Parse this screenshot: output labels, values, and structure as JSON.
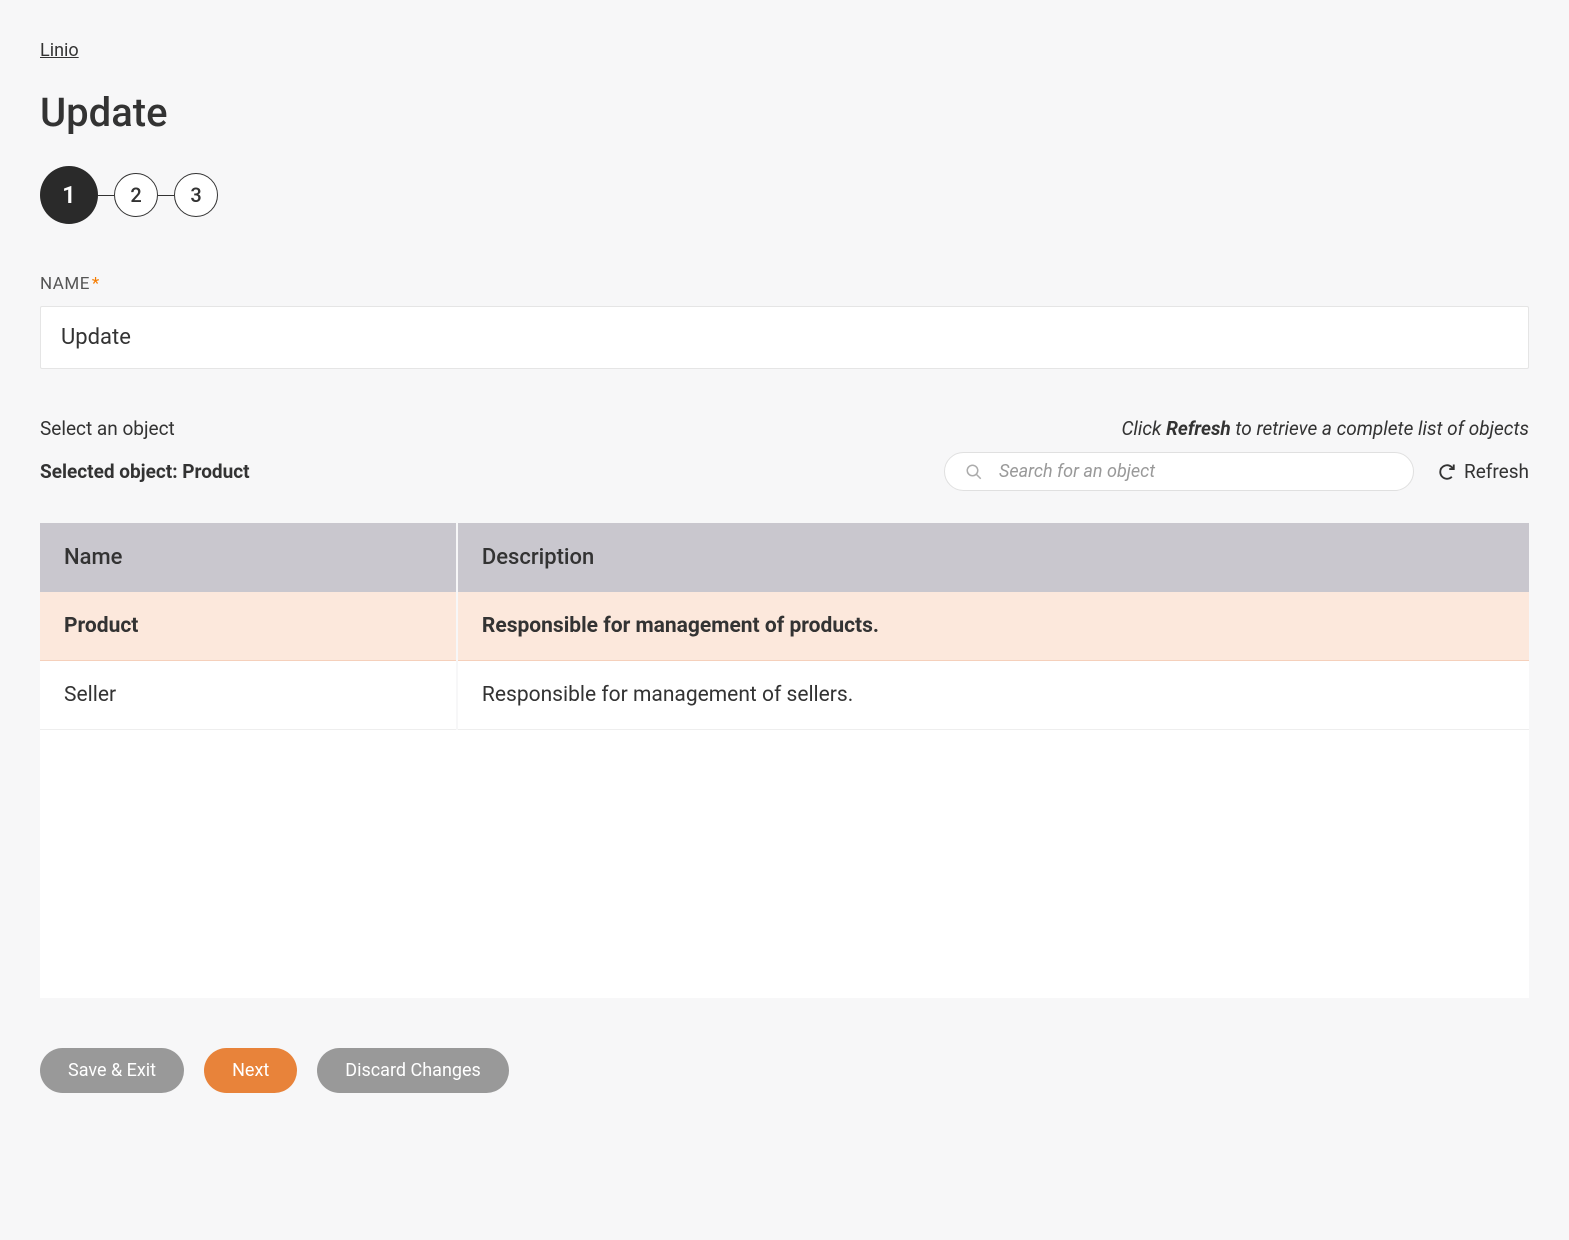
{
  "breadcrumb": "Linio",
  "page_title": "Update",
  "stepper": {
    "steps": [
      "1",
      "2",
      "3"
    ],
    "active_index": 0
  },
  "name_field": {
    "label": "NAME",
    "required_mark": "*",
    "value": "Update"
  },
  "object_section": {
    "label": "Select an object",
    "hint_prefix": "Click ",
    "hint_bold": "Refresh",
    "hint_suffix": " to retrieve a complete list of objects",
    "selected_prefix": "Selected object: ",
    "selected_value": "Product",
    "search_placeholder": "Search for an object",
    "refresh_label": "Refresh"
  },
  "table": {
    "columns": [
      "Name",
      "Description"
    ],
    "rows": [
      {
        "name": "Product",
        "description": "Responsible for management of products.",
        "selected": true
      },
      {
        "name": "Seller",
        "description": "Responsible for management of sellers.",
        "selected": false
      }
    ]
  },
  "buttons": {
    "save_exit": "Save & Exit",
    "next": "Next",
    "discard": "Discard Changes"
  }
}
